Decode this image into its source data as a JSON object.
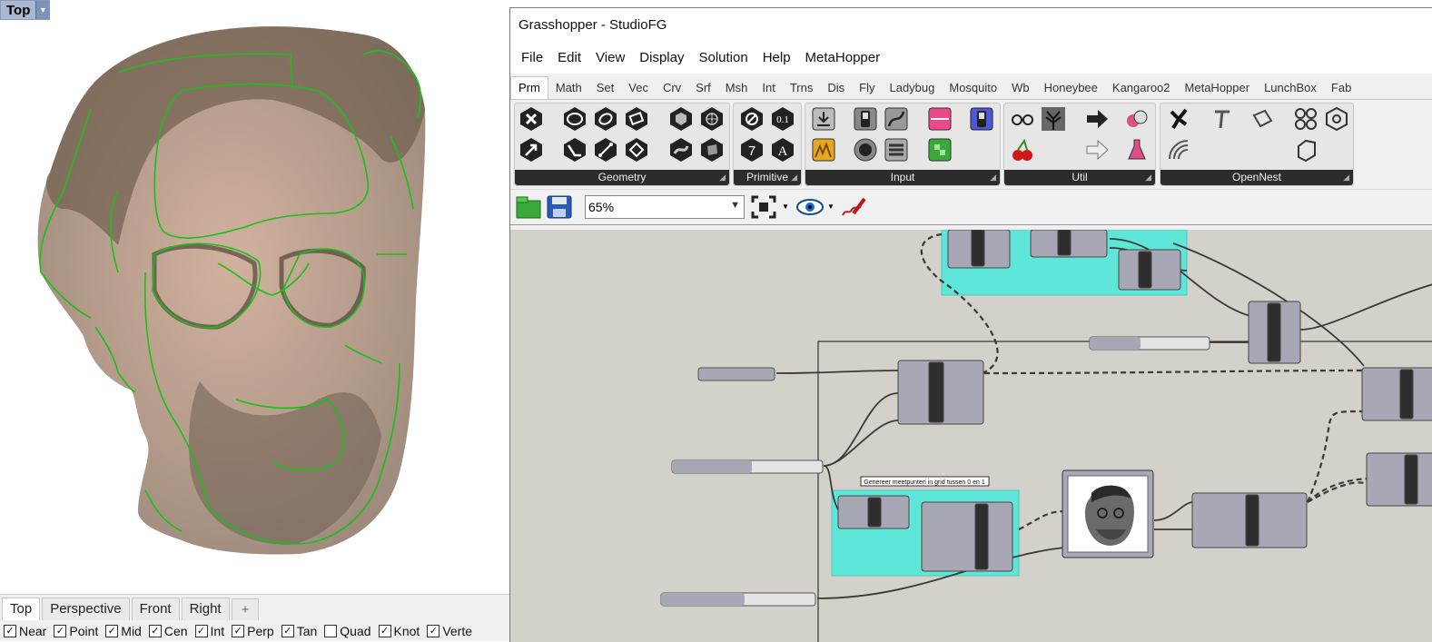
{
  "rhino": {
    "viewport_label": "Top",
    "viewport_tabs": [
      "Top",
      "Perspective",
      "Front",
      "Right"
    ],
    "add_tab_glyph": "+",
    "osnaps": [
      {
        "label": "Near",
        "checked": true
      },
      {
        "label": "Point",
        "checked": true
      },
      {
        "label": "Mid",
        "checked": true
      },
      {
        "label": "Cen",
        "checked": true
      },
      {
        "label": "Int",
        "checked": true
      },
      {
        "label": "Perp",
        "checked": true
      },
      {
        "label": "Tan",
        "checked": true
      },
      {
        "label": "Quad",
        "checked": false
      },
      {
        "label": "Knot",
        "checked": true
      },
      {
        "label": "Verte",
        "checked": true
      }
    ]
  },
  "grasshopper": {
    "title": "Grasshopper - StudioFG",
    "menu": [
      "File",
      "Edit",
      "View",
      "Display",
      "Solution",
      "Help",
      "MetaHopper"
    ],
    "tabs": [
      "Prm",
      "Math",
      "Set",
      "Vec",
      "Crv",
      "Srf",
      "Msh",
      "Int",
      "Trns",
      "Dis",
      "Fly",
      "Ladybug",
      "Mosquito",
      "Wb",
      "Honeybee",
      "Kangaroo2",
      "MetaHopper",
      "LunchBox",
      "Fab"
    ],
    "active_tab": "Prm",
    "ribbon_groups": [
      "Geometry",
      "Primitive",
      "Input",
      "Util",
      "OpenNest"
    ],
    "zoom": "65%",
    "tooltip": "Genereer meetpunten in grid tussen 0 en 1",
    "colors": {
      "group_fill": "#5ee6d8",
      "canvas": "#d4d1ca",
      "component": "#a8a7b5",
      "ribbon_bar": "#2c2c2c"
    }
  }
}
